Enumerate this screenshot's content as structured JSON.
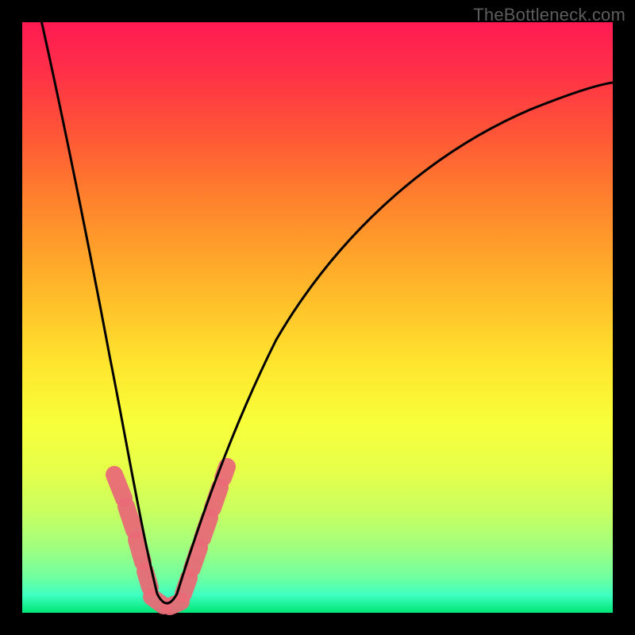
{
  "watermark": "TheBottleneck.com",
  "colors": {
    "frame": "#000000",
    "curve": "#000000",
    "overlay_band": "#e86a77",
    "gradient_top": "#ff1a52",
    "gradient_bottom": "#00e676"
  },
  "chart_data": {
    "type": "line",
    "title": "",
    "xlabel": "",
    "ylabel": "",
    "xlim": [
      0,
      100
    ],
    "ylim": [
      0,
      100
    ],
    "grid": false,
    "legend": false,
    "series": [
      {
        "name": "bottleneck-curve",
        "x": [
          0,
          2,
          4,
          6,
          8,
          10,
          12,
          14,
          16,
          18,
          19,
          20,
          21,
          22,
          23,
          24,
          25,
          26,
          28,
          30,
          34,
          38,
          44,
          50,
          58,
          66,
          76,
          88,
          100
        ],
        "y": [
          103,
          92,
          80,
          69,
          58,
          47,
          37,
          27,
          18,
          10,
          7,
          4,
          2,
          1,
          1,
          2,
          4,
          7,
          13,
          19,
          30,
          39,
          50,
          58,
          66,
          72,
          78,
          83,
          87
        ]
      }
    ],
    "overlay_segments": {
      "description": "Dashed salmon highlights near curve minimum",
      "left_branch": [
        {
          "x": 14.5,
          "y": 25
        },
        {
          "x": 15.8,
          "y": 19
        },
        {
          "x": 17.2,
          "y": 12
        },
        {
          "x": 18.5,
          "y": 7
        },
        {
          "x": 19.8,
          "y": 3
        }
      ],
      "right_branch": [
        {
          "x": 24.5,
          "y": 3
        },
        {
          "x": 26.0,
          "y": 7
        },
        {
          "x": 27.5,
          "y": 12
        },
        {
          "x": 29.0,
          "y": 17
        },
        {
          "x": 30.5,
          "y": 22
        }
      ],
      "bottom": [
        {
          "x": 20.5,
          "y": 1
        },
        {
          "x": 23.5,
          "y": 1
        }
      ]
    },
    "background": {
      "type": "vertical-gradient",
      "stops": [
        {
          "pos": 0.0,
          "color": "#ff1a52"
        },
        {
          "pos": 0.5,
          "color": "#ffe62e"
        },
        {
          "pos": 1.0,
          "color": "#00e676"
        }
      ]
    }
  }
}
